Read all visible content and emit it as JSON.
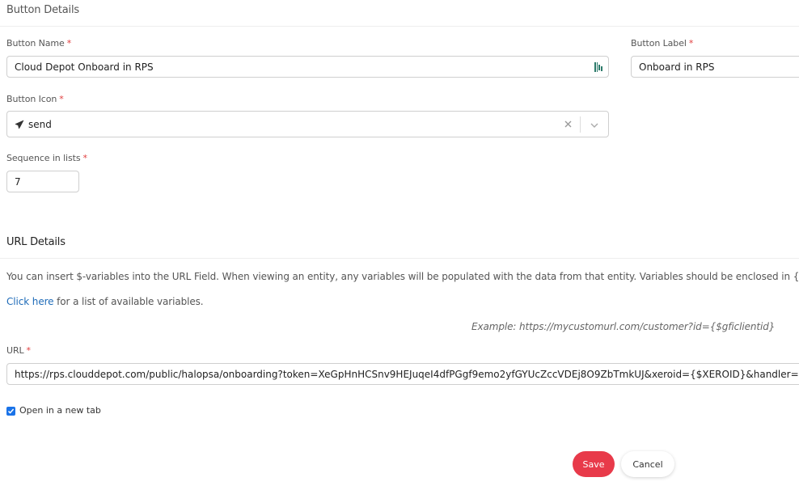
{
  "sections": {
    "button_details": "Button Details",
    "url_details": "URL Details"
  },
  "fields": {
    "button_name": {
      "label": "Button Name",
      "required": "*",
      "value": "Cloud Depot Onboard in RPS",
      "icon": "barcode-icon"
    },
    "button_label": {
      "label": "Button Label",
      "required": "*",
      "value": "Onboard in RPS"
    },
    "button_icon": {
      "label": "Button Icon",
      "required": "*",
      "value": "send",
      "icon": "send-icon"
    },
    "sequence": {
      "label": "Sequence in lists",
      "required": "*",
      "value": "7"
    },
    "url": {
      "label": "URL",
      "required": "*",
      "value": "https://rps.clouddepot.com/public/halopsa/onboarding?token=XeGpHnHCSnv9HEJuqeI4dfPGgf9emo2yfGYUcZccVDEj8O9ZbTmkUJ&xeroid={$XEROID}&handler=halo"
    }
  },
  "url_help": {
    "description": "You can insert $-variables into the URL Field. When viewing an entity, any variables will be populated with the data from that entity. Variables should be enclosed in {} tag",
    "link_text": "Click here",
    "link_suffix": " for a list of available variables.",
    "example": "Example: https://mycustomurl.com/customer?id={$gficlientid}"
  },
  "open_new_tab": {
    "label": "Open in a new tab",
    "checked": true
  },
  "actions": {
    "save": "Save",
    "cancel": "Cancel"
  },
  "colors": {
    "save": "#e83a4a",
    "link": "#1e6bb8",
    "required": "#e03c3c",
    "checkbox": "#1a73e8"
  }
}
